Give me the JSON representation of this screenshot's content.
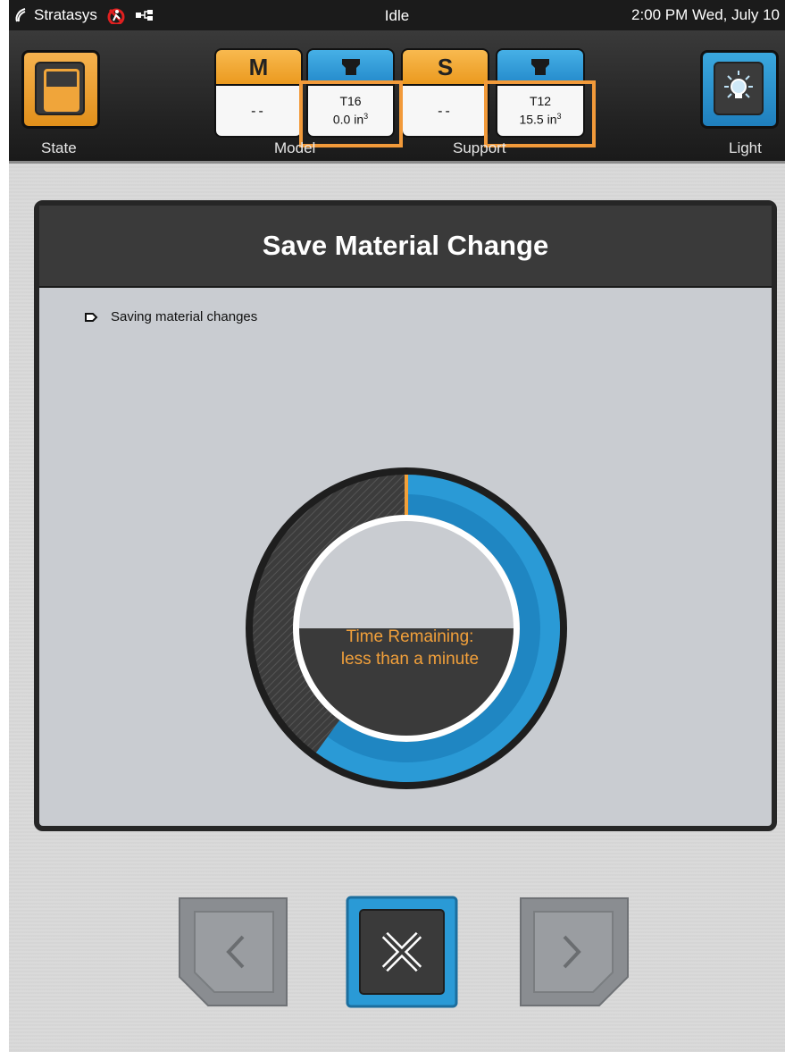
{
  "status_bar": {
    "brand": "Stratasys",
    "state": "Idle",
    "datetime": "2:00 PM Wed, July 10"
  },
  "header": {
    "state_label": "State",
    "light_label": "Light",
    "model_label": "Model",
    "support_label": "Support",
    "bays": [
      {
        "tab": "M",
        "value": "--"
      },
      {
        "tab": "",
        "line1": "T16",
        "line2": "0.0 in",
        "sup": "3"
      },
      {
        "tab": "S",
        "value": "--"
      },
      {
        "tab": "",
        "line1": "T12",
        "line2": "15.5 in",
        "sup": "3"
      }
    ]
  },
  "panel": {
    "title": "Save Material Change",
    "step_text": "Saving material changes",
    "time_line1": "Time Remaining:",
    "time_line2": "less than a minute",
    "progress_fraction": 0.6
  },
  "colors": {
    "accent_orange": "#f29a3a",
    "accent_blue": "#2a9ad6"
  }
}
